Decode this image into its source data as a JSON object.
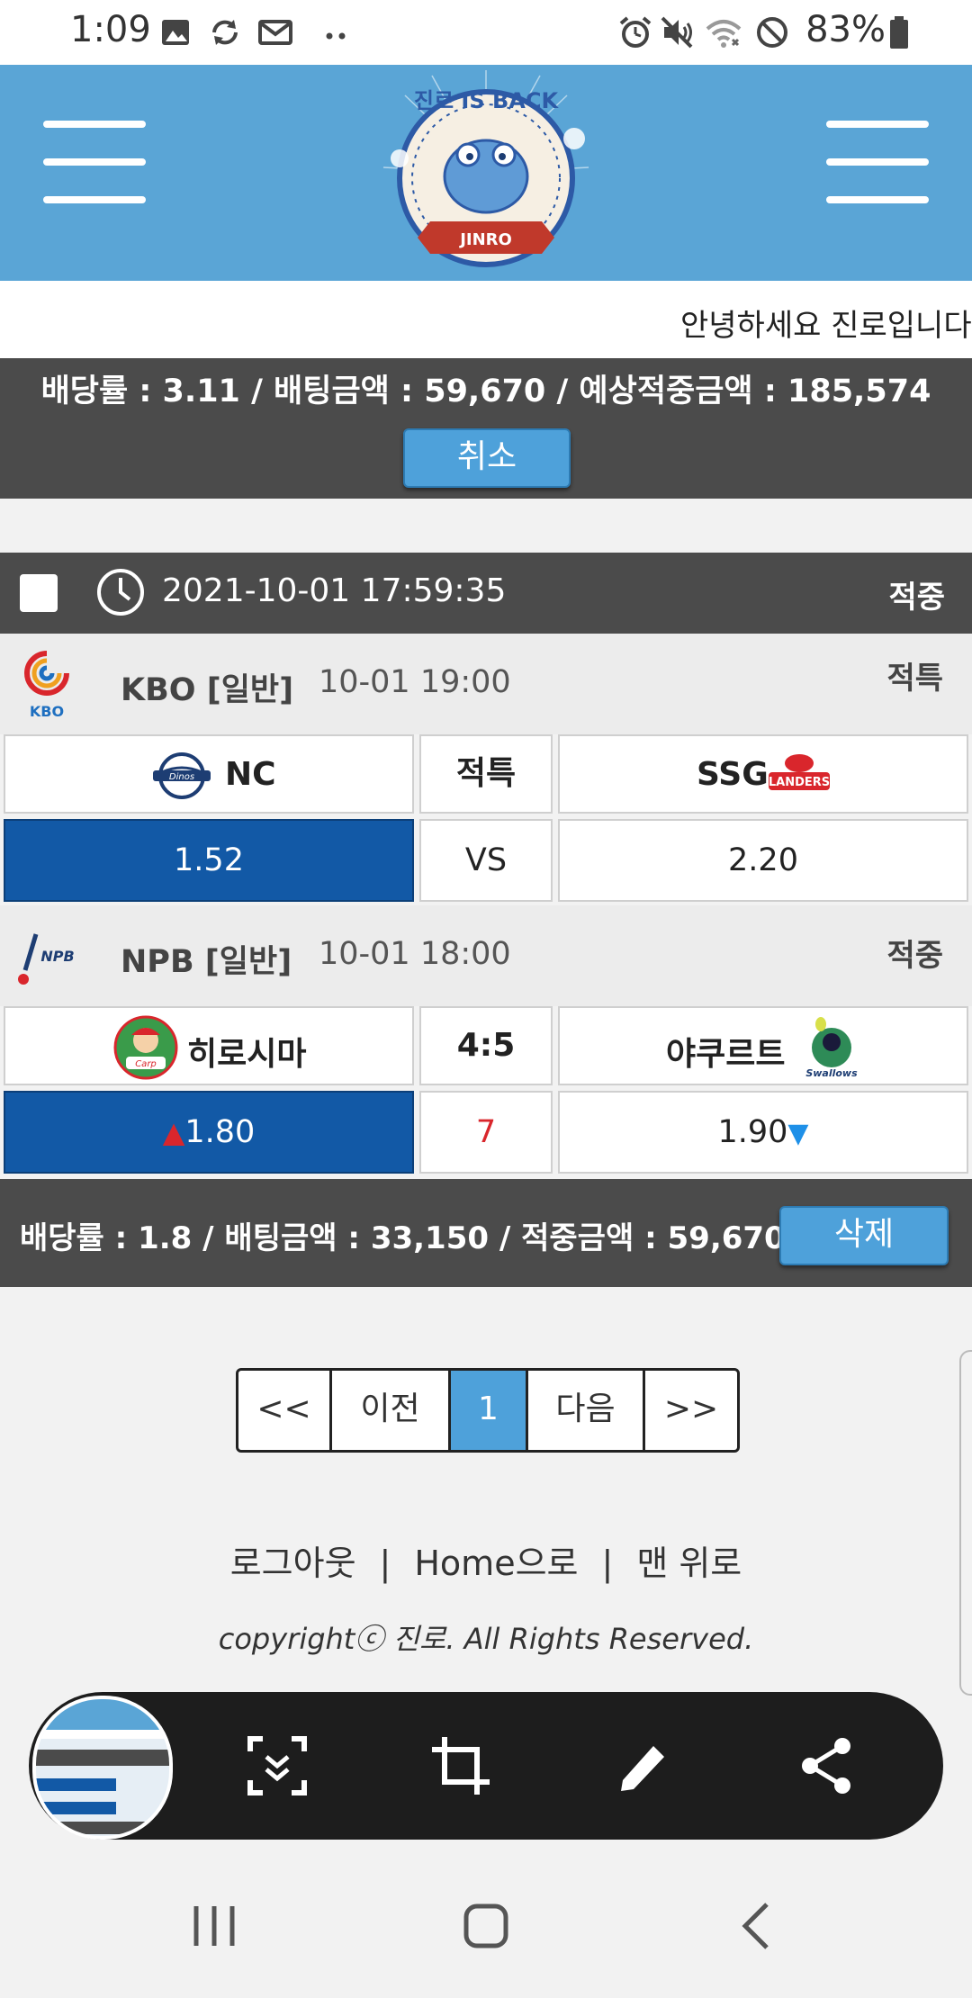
{
  "status_bar": {
    "time": "1:09",
    "battery": "83%",
    "icons": [
      "image-icon",
      "sync-icon",
      "mail-icon",
      "more-dots-icon",
      "alarm-icon",
      "mute-icon",
      "wifi-icon",
      "blocked-icon",
      "battery-icon"
    ]
  },
  "header": {
    "logo_text_top": "진로 IS BACK",
    "logo_text_ribbon": "JINRO",
    "colors": {
      "bar": "#5aa5d6",
      "logo_ring": "#2d5aa6",
      "ribbon": "#c0392b"
    }
  },
  "marquee": {
    "text": "안녕하세요 진로입니다"
  },
  "prev_bet_summary": {
    "text": "배당률 : 3.11 / 배팅금액 : 59,670 / 예상적중금액 : 185,574",
    "cancel_label": "취소"
  },
  "bet": {
    "datetime": "2021-10-01 17:59:35",
    "status": "적중",
    "games": [
      {
        "league_logo": "kbo-logo-icon",
        "league_logo_text": "KBO",
        "league": "KBO  [일반]",
        "time": "10-01 19:00",
        "result": "적특",
        "home": "NC",
        "home_logo": "nc-dinos-logo-icon",
        "center": "적특",
        "away": "SSG",
        "away_logo": "ssg-landers-logo-icon",
        "home_odds": "1.52",
        "center_odds": "VS",
        "away_odds": "2.20",
        "selected": "home"
      },
      {
        "league_logo": "npb-logo-icon",
        "league_logo_text": "NPB",
        "league": "NPB  [일반]",
        "time": "10-01 18:00",
        "result": "적중",
        "home": "히로시마",
        "home_logo": "hiroshima-carp-logo-icon",
        "center": "4:5",
        "away": "야쿠르트",
        "away_logo": "yakult-swallows-logo-icon",
        "home_odds": "1.80",
        "center_odds": "7",
        "away_odds": "1.90",
        "selected": "home"
      }
    ],
    "footer_text": "배당률 : 1.8 / 배팅금액 : 33,150 / 적중금액 : 59,670",
    "delete_label": "삭제"
  },
  "pagination": {
    "first": "<<",
    "prev": "이전",
    "current": "1",
    "next": "다음",
    "last": ">>"
  },
  "footer": {
    "logout": "로그아웃",
    "sep": "|",
    "home": "Home으로",
    "top": "맨 위로",
    "copyright": "copyrightⓒ 진로. All Rights Reserved."
  },
  "screenshot_toolbar": {
    "icons": [
      "screenshot-thumbnail",
      "scroll-capture-icon",
      "crop-icon",
      "edit-pen-icon",
      "share-icon"
    ]
  },
  "nav_bar": {
    "icons": [
      "recent-apps-icon",
      "home-icon",
      "back-icon"
    ]
  },
  "colors": {
    "accent": "#4ea1da",
    "selected_odds": "#1259a6",
    "dark_bar": "#4b4b4b",
    "up_arrow": "#d9262c",
    "down_arrow": "#1e90e8",
    "score_red": "#d9262c"
  }
}
